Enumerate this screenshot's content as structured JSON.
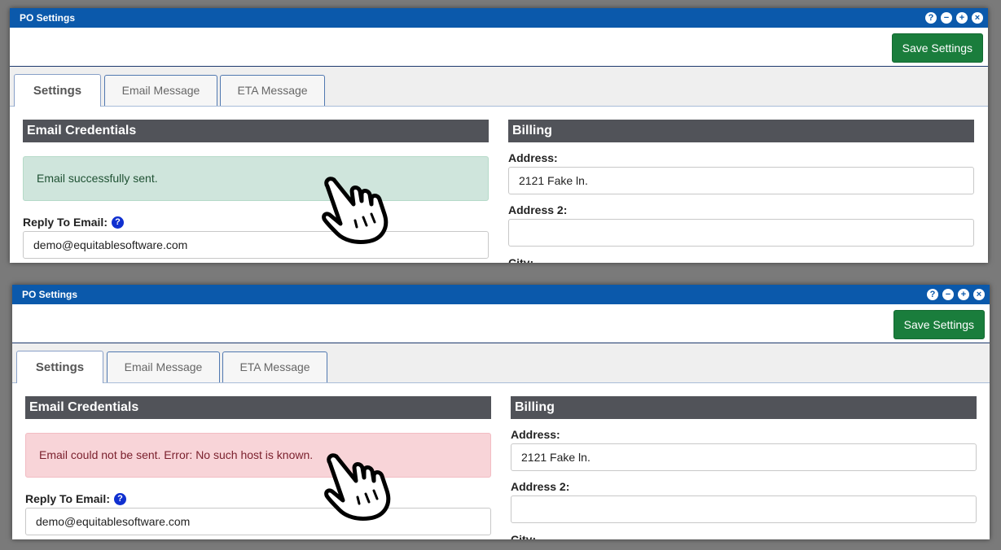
{
  "windows": [
    {
      "title": "PO Settings",
      "controls": {
        "help": "?",
        "minimize": "−",
        "maximize": "+",
        "close": "×"
      },
      "toolbar": {
        "save_label": "Save Settings"
      },
      "tabs": [
        "Settings",
        "Email Message",
        "ETA Message"
      ],
      "email_credentials": {
        "header": "Email Credentials",
        "alert_type": "success",
        "alert_text": "Email successfully sent.",
        "reply_to_label": "Reply To Email:",
        "reply_to_value": "demo@equitablesoftware.com"
      },
      "billing": {
        "header": "Billing",
        "address_label": "Address:",
        "address_value": "2121 Fake ln.",
        "address2_label": "Address 2:",
        "address2_value": "",
        "city_label": "City:"
      }
    },
    {
      "title": "PO Settings",
      "controls": {
        "help": "?",
        "minimize": "−",
        "maximize": "+",
        "close": "×"
      },
      "toolbar": {
        "save_label": "Save Settings"
      },
      "tabs": [
        "Settings",
        "Email Message",
        "ETA Message"
      ],
      "email_credentials": {
        "header": "Email Credentials",
        "alert_type": "error",
        "alert_text": "Email could not be sent. Error: No such host is known.",
        "reply_to_label": "Reply To Email:",
        "reply_to_value": "demo@equitablesoftware.com"
      },
      "billing": {
        "header": "Billing",
        "address_label": "Address:",
        "address_value": "2121 Fake ln.",
        "address2_label": "Address 2:",
        "address2_value": "",
        "city_label": "City:"
      }
    }
  ],
  "colors": {
    "titlebar": "#0b59ab",
    "save_button": "#1a7d3c",
    "section_header": "#515359",
    "success_alert": "#cfe5dc",
    "error_alert": "#f8d4d8",
    "help_icon": "#1030d0"
  },
  "icons": [
    "help-icon",
    "minimize-icon",
    "maximize-icon",
    "close-icon",
    "pointing-hand-cursor-icon"
  ]
}
